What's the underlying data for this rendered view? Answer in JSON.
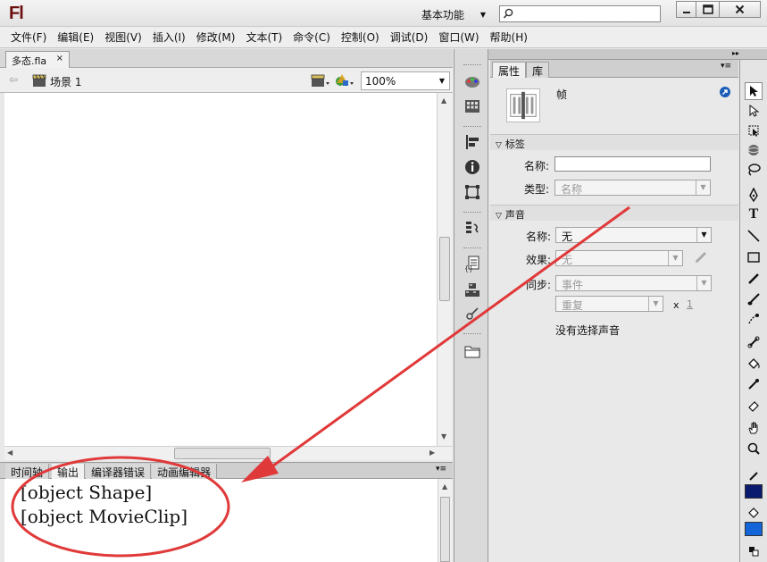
{
  "app": {
    "logo": "Fl",
    "workspace_label": "基本功能",
    "search": {
      "value": "",
      "placeholder": ""
    }
  },
  "menu": [
    "文件(F)",
    "编辑(E)",
    "视图(V)",
    "插入(I)",
    "修改(M)",
    "文本(T)",
    "命令(C)",
    "控制(O)",
    "调试(D)",
    "窗口(W)",
    "帮助(H)"
  ],
  "document": {
    "tab_label": "多态.fla",
    "tab_close": "×",
    "scene_label": "场景 1",
    "zoom": "100%"
  },
  "bottom_panel": {
    "tabs": [
      "时间轴",
      "输出",
      "编译器错误",
      "动画编辑器"
    ],
    "active_tab": 1,
    "output_lines": [
      "[object Shape]",
      "[object MovieClip]"
    ]
  },
  "properties": {
    "tabs": [
      "属性",
      "库"
    ],
    "active_tab": 0,
    "frame_label": "帧",
    "label_section": {
      "title": "标签",
      "name_label": "名称:",
      "name_value": "",
      "type_label": "类型:",
      "type_value": "名称"
    },
    "sound_section": {
      "title": "声音",
      "name_label": "名称:",
      "name_value": "无",
      "effect_label": "效果:",
      "effect_value": "无",
      "sync_label": "同步:",
      "sync_value": "事件",
      "repeat_value": "重复",
      "repeat_x": "x",
      "repeat_count": "1",
      "no_sound": "没有选择声音"
    }
  },
  "colors": {
    "stroke_color": "#0a1a6e",
    "fill_color": "#1466d8",
    "annotation": "#e0393a",
    "logo": "#6b0f0f"
  }
}
